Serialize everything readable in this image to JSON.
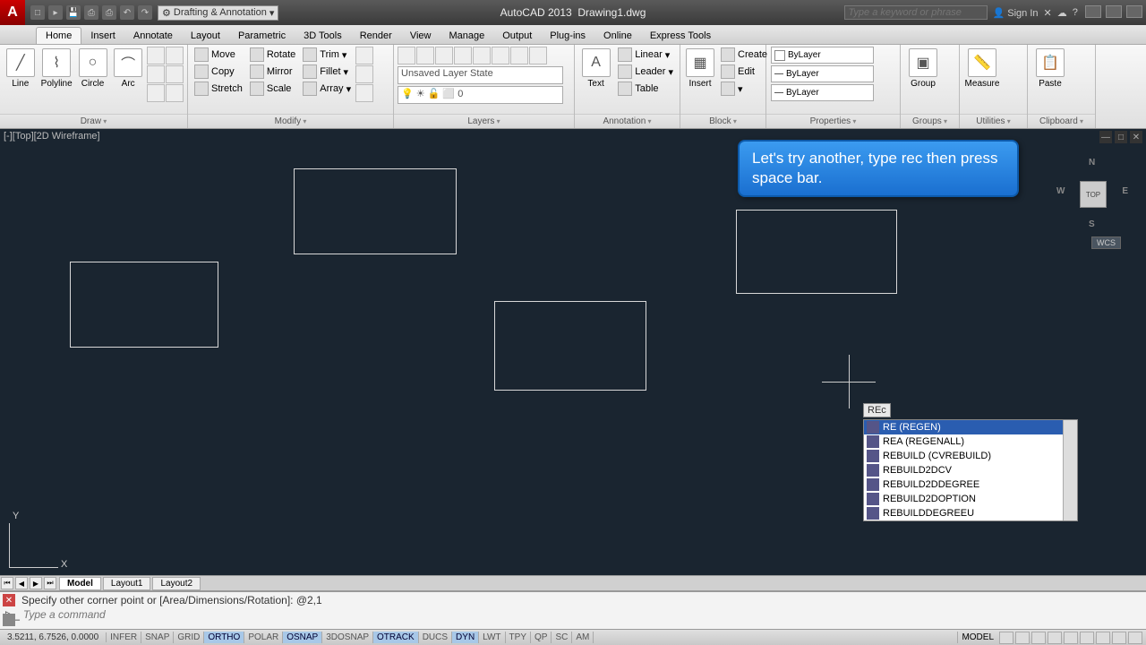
{
  "title": {
    "app": "AutoCAD 2013",
    "doc": "Drawing1.dwg"
  },
  "workspace": "Drafting & Annotation",
  "search_placeholder": "Type a keyword or phrase",
  "signin": "Sign In",
  "tabs": [
    "Home",
    "Insert",
    "Annotate",
    "Layout",
    "Parametric",
    "3D Tools",
    "Render",
    "View",
    "Manage",
    "Output",
    "Plug-ins",
    "Online",
    "Express Tools"
  ],
  "active_tab": "Home",
  "panels": {
    "draw": {
      "title": "Draw",
      "items": [
        "Line",
        "Polyline",
        "Circle",
        "Arc"
      ]
    },
    "modify": {
      "title": "Modify",
      "items": [
        "Move",
        "Copy",
        "Stretch",
        "Rotate",
        "Mirror",
        "Scale",
        "Trim",
        "Fillet",
        "Array"
      ]
    },
    "layers": {
      "title": "Layers",
      "state": "Unsaved Layer State",
      "current": "0"
    },
    "annotation": {
      "title": "Annotation",
      "text": "Text",
      "linear": "Linear",
      "leader": "Leader",
      "table": "Table"
    },
    "block": {
      "title": "Block",
      "insert": "Insert",
      "create": "Create",
      "edit": "Edit"
    },
    "properties": {
      "title": "Properties",
      "bylayer": "ByLayer"
    },
    "groups": {
      "title": "Groups",
      "group": "Group"
    },
    "utilities": {
      "title": "Utilities",
      "measure": "Measure"
    },
    "clipboard": {
      "title": "Clipboard",
      "paste": "Paste"
    }
  },
  "viewport_label": "[-][Top][2D Wireframe]",
  "callout": "Let's try another, type rec then press space bar.",
  "viewcube": {
    "top": "TOP",
    "n": "N",
    "s": "S",
    "e": "E",
    "w": "W",
    "wcs": "WCS"
  },
  "dyninput": "REc",
  "autocomplete": [
    "RE (REGEN)",
    "REA (REGENALL)",
    "REBUILD (CVREBUILD)",
    "REBUILD2DCV",
    "REBUILD2DDEGREE",
    "REBUILD2DOPTION",
    "REBUILDDEGREEU"
  ],
  "layout_tabs": [
    "Model",
    "Layout1",
    "Layout2"
  ],
  "cmd_history": "Specify other corner point or [Area/Dimensions/Rotation]: @2,1",
  "cmd_placeholder": "Type a command",
  "coords": "3.5211, 6.7526, 0.0000",
  "status_toggles": [
    "INFER",
    "SNAP",
    "GRID",
    "ORTHO",
    "POLAR",
    "OSNAP",
    "3DOSNAP",
    "OTRACK",
    "DUCS",
    "DYN",
    "LWT",
    "TPY",
    "QP",
    "SC",
    "AM"
  ],
  "status_on": [
    "ORTHO",
    "OSNAP",
    "OTRACK",
    "DYN"
  ],
  "model_label": "MODEL",
  "ucs": {
    "x": "X",
    "y": "Y"
  }
}
